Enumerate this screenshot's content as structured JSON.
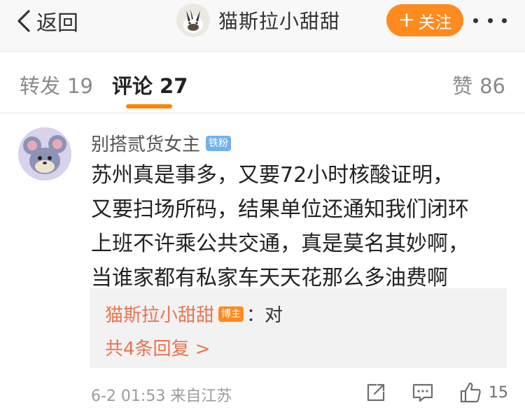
{
  "header": {
    "back_label": "返回",
    "account_name": "猫斯拉小甜甜",
    "follow_label": "关注"
  },
  "tabs": {
    "repost": {
      "label": "转发",
      "count": "19"
    },
    "comments": {
      "label": "评论",
      "count": "27"
    },
    "likes": {
      "label": "赞",
      "count": "86"
    }
  },
  "comment": {
    "author": "别搭贰货女主",
    "badge": "铁粉",
    "lines": [
      "苏州真是事多，又要72小时核酸证明，",
      "又要扫场所码，结果单位还通知我们闭环",
      "上班不许乘公共交通，真是莫名其妙啊，",
      "当谁家都有私家车天天花那么多油费啊"
    ],
    "reply": {
      "author": "猫斯拉小甜甜",
      "badge": "博主",
      "text": "：对",
      "more": "共4条回复 >"
    },
    "time_source": "6-2 01:53 来自江苏",
    "like_count": "15"
  },
  "colors": {
    "accent": "#ff8200",
    "link": "#eb7350",
    "fan_badge": "#73b1ea"
  },
  "icons": [
    "chevron-left-icon",
    "more-icon",
    "share-icon",
    "comment-icon",
    "thumbs-up-icon"
  ]
}
